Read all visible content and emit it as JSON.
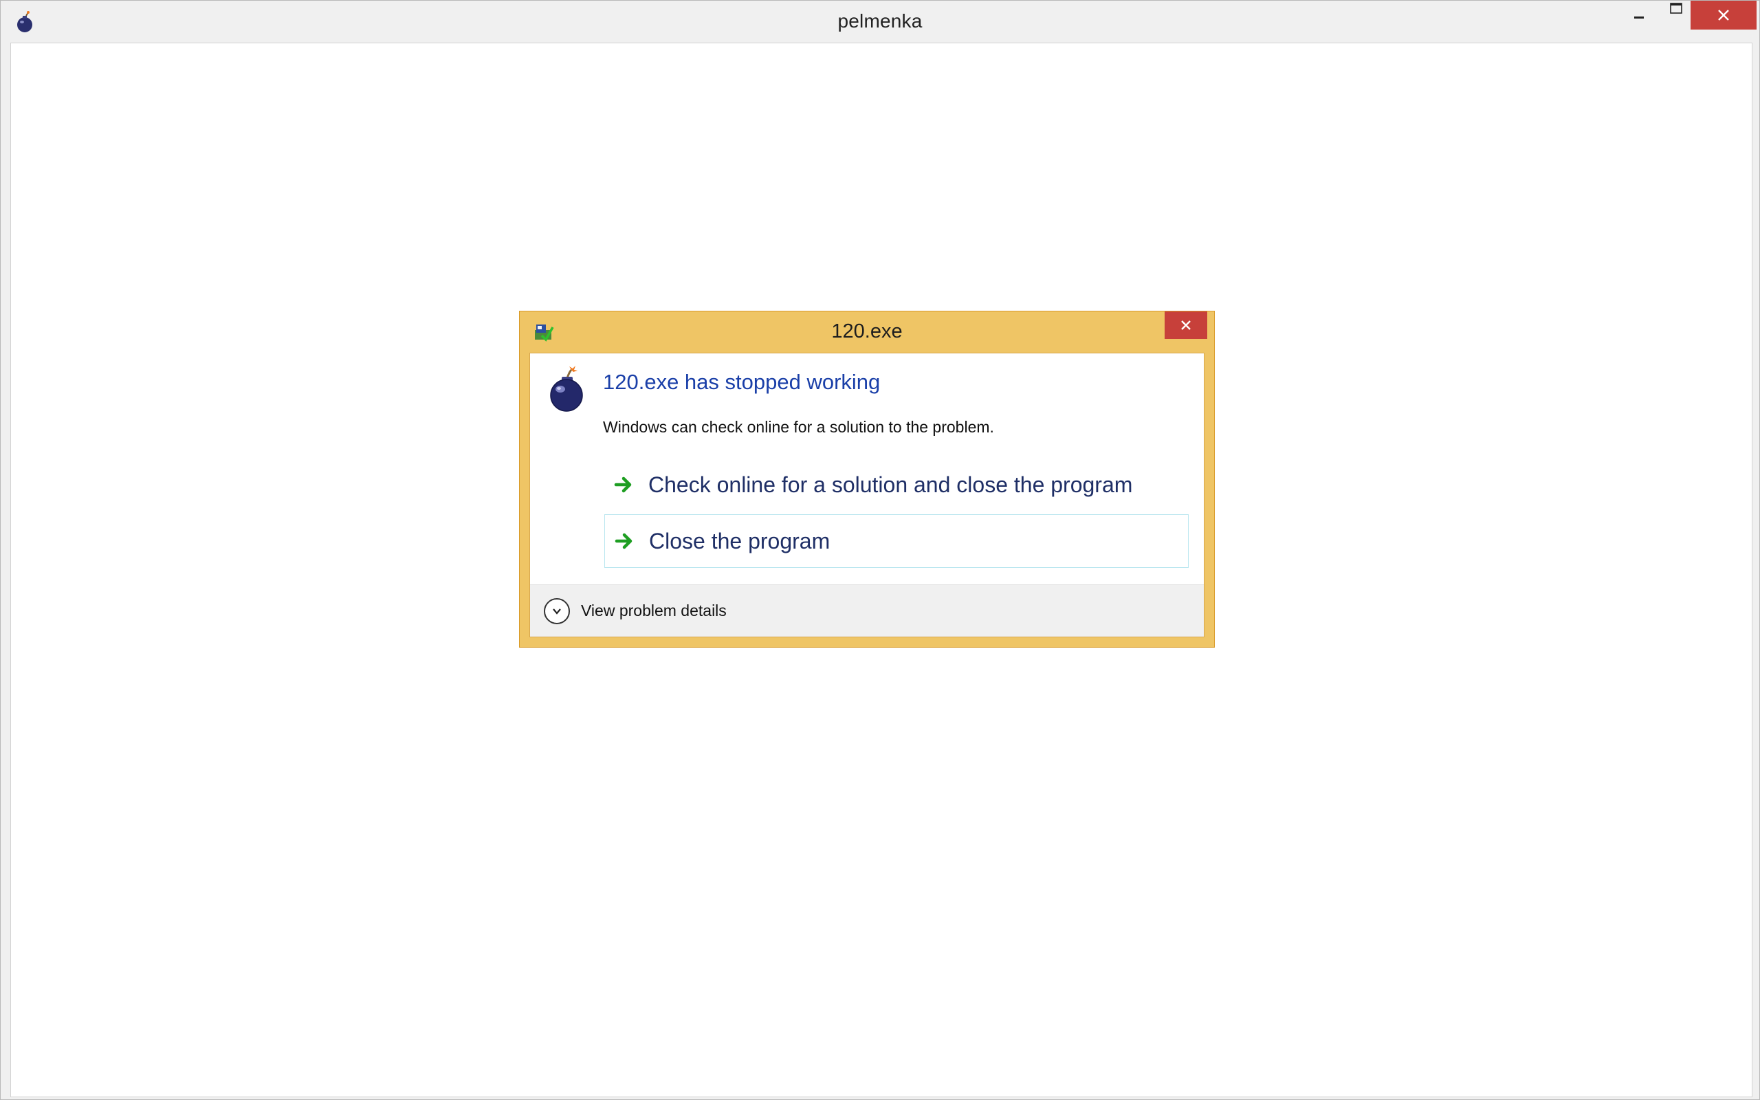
{
  "window": {
    "title": "pelmenka",
    "icons": {
      "app": "bomb-icon",
      "minimize": "minimize-icon",
      "maximize": "maximize-icon",
      "close": "close-icon"
    },
    "close_button_color": "#c7403a"
  },
  "dialog": {
    "title": "120.exe",
    "frame_color": "#efc565",
    "heading": "120.exe has stopped working",
    "heading_color": "#1a3fa8",
    "description": "Windows can check online for a solution to the problem.",
    "options": [
      {
        "label": "Check online for a solution and close the program",
        "icon": "green-arrow-icon"
      },
      {
        "label": "Close the program",
        "icon": "green-arrow-icon"
      }
    ],
    "details_label": "View problem details",
    "icons": {
      "title": "error-reporting-icon",
      "body": "bomb-icon",
      "close": "close-icon",
      "expand": "chevron-down-icon"
    }
  }
}
